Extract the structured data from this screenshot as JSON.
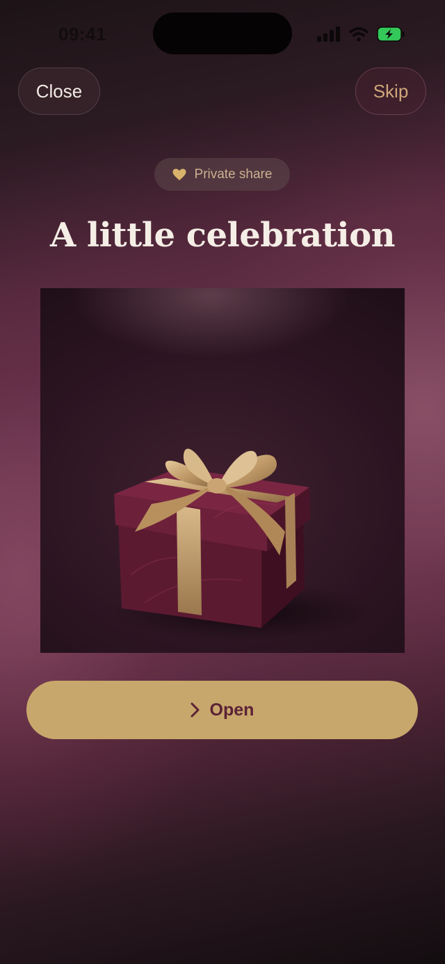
{
  "status_bar": {
    "time": "09:41",
    "icons": [
      "signal-icon",
      "wifi-icon",
      "battery-charging-icon"
    ]
  },
  "header": {
    "close_label": "Close",
    "skip_label": "Skip"
  },
  "badge": {
    "icon": "heart-icon",
    "label": "Private share"
  },
  "title": "A little celebration",
  "hero_image": {
    "subject": "gift-box-with-gold-ribbon"
  },
  "primary_action": {
    "icon": "chevron-right-icon",
    "label": "Open"
  },
  "colors": {
    "accent_gold": "#c8a76c",
    "button_text": "#5b2235",
    "title_text": "#f5eee6",
    "battery_green": "#34c759"
  }
}
